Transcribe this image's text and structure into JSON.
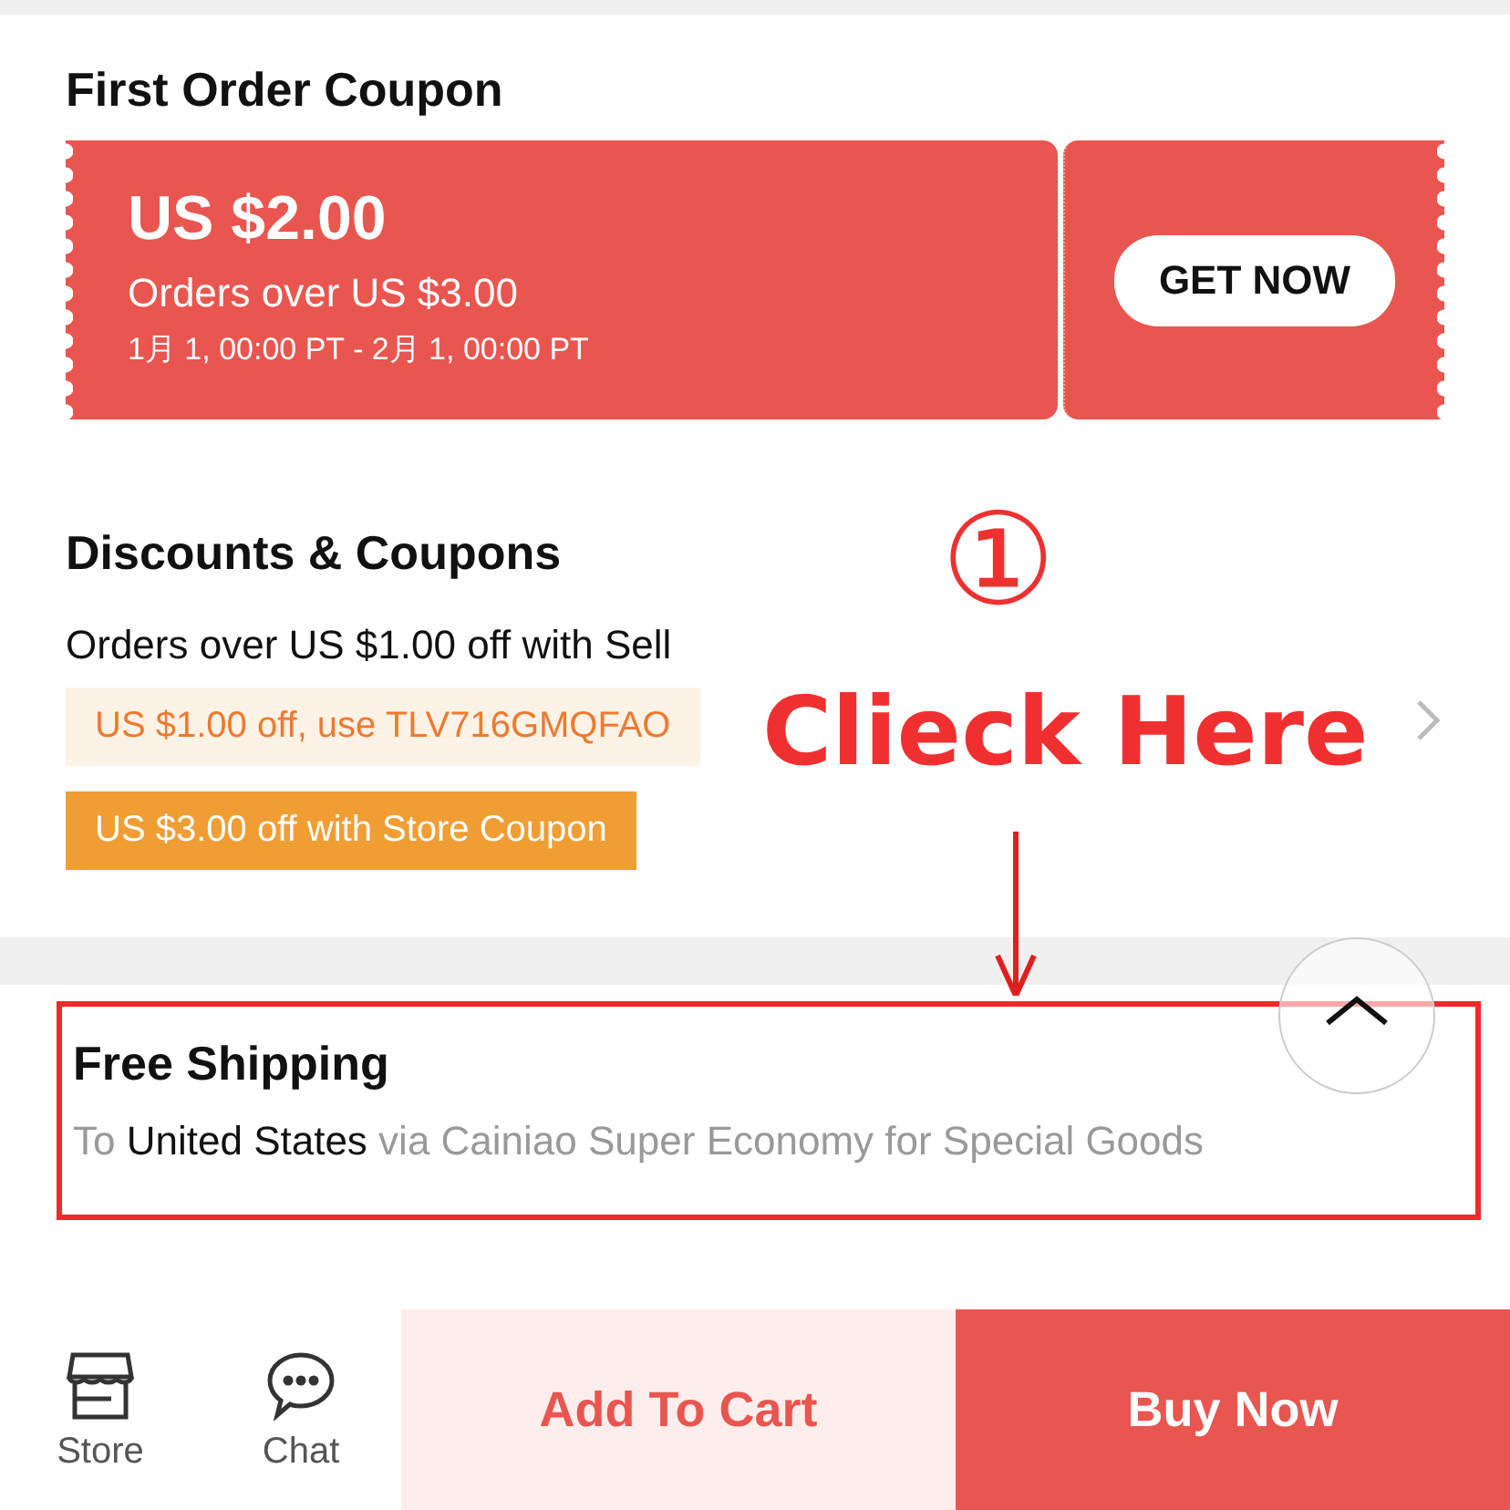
{
  "first_order_coupon": {
    "title": "First Order Coupon",
    "amount": "US $2.00",
    "condition": "Orders over US $3.00",
    "validity": "1月 1, 00:00 PT - 2月 1, 00:00 PT",
    "button": "GET NOW"
  },
  "discounts": {
    "title": "Discounts & Coupons",
    "line": "Orders over US $1.00 off with Sell",
    "tags": [
      {
        "text": "US $1.00 off, use TLV716GMQFAO",
        "kind": "code"
      },
      {
        "text": "US $3.00 off with Store Coupon",
        "kind": "store"
      }
    ]
  },
  "shipping": {
    "title": "Free Shipping",
    "line": "To **United States** via Cainiao Super Economy for Special Goods"
  },
  "bottom_bar": {
    "icons": [
      {
        "label": "Store",
        "kind": "store"
      },
      {
        "label": "Chat",
        "kind": "chat"
      }
    ],
    "buttons": [
      {
        "label": "Add To Cart",
        "kind": "secondary"
      },
      {
        "label": "Buy Now",
        "kind": "primary"
      }
    ]
  },
  "annotation": {
    "step": "①",
    "text": "Clieck Here"
  }
}
